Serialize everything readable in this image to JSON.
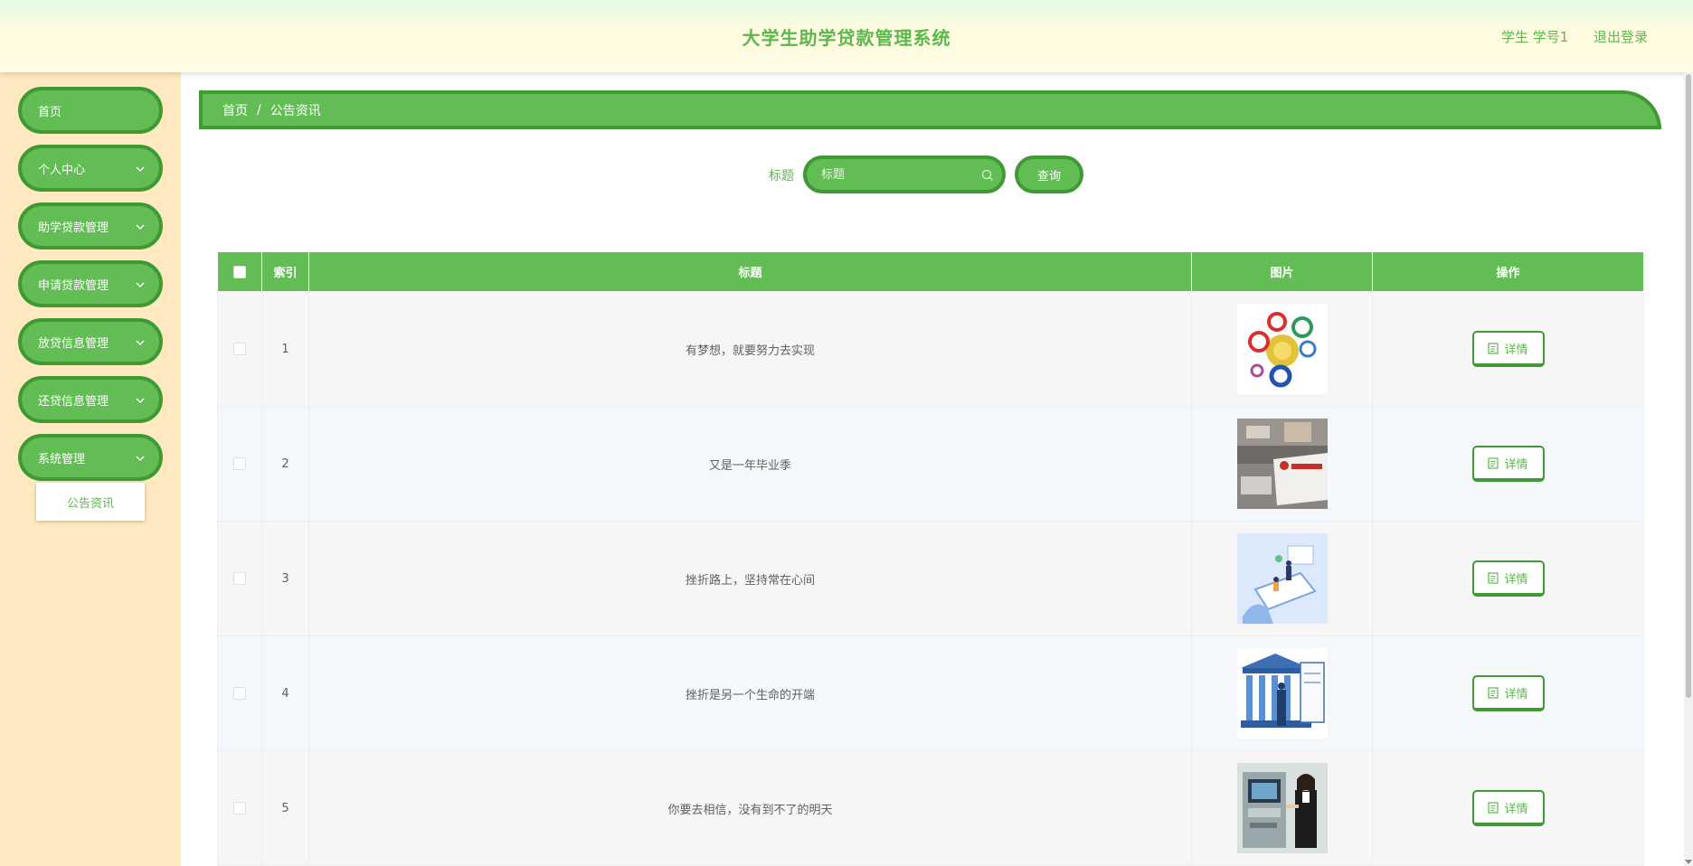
{
  "header": {
    "title": "大学生助学贷款管理系统",
    "user_label": "学生 学号1",
    "logout_label": "退出登录"
  },
  "sidebar": {
    "items": [
      {
        "label": "首页",
        "has_children": false
      },
      {
        "label": "个人中心",
        "has_children": true
      },
      {
        "label": "助学贷款管理",
        "has_children": true
      },
      {
        "label": "申请贷款管理",
        "has_children": true
      },
      {
        "label": "放贷信息管理",
        "has_children": true
      },
      {
        "label": "还贷信息管理",
        "has_children": true
      },
      {
        "label": "系统管理",
        "has_children": true
      }
    ],
    "submenu": {
      "label": "公告资讯"
    }
  },
  "breadcrumb": {
    "home": "首页",
    "separator": "/",
    "current": "公告资讯"
  },
  "search": {
    "label": "标题",
    "placeholder": "标题",
    "value": "",
    "button_label": "查询"
  },
  "table": {
    "columns": [
      "索引",
      "标题",
      "图片",
      "操作"
    ],
    "rows": [
      {
        "index": "1",
        "title": "有梦想，就要努力去实现",
        "image_icon": "bank-logos-thumbnail",
        "action_label": "详情"
      },
      {
        "index": "2",
        "title": "又是一年毕业季",
        "image_icon": "bank-counter-thumbnail",
        "action_label": "详情"
      },
      {
        "index": "3",
        "title": "挫折路上，坚持常在心间",
        "image_icon": "phone-illustration-thumbnail",
        "action_label": "详情"
      },
      {
        "index": "4",
        "title": "挫折是另一个生命的开端",
        "image_icon": "bank-building-thumbnail",
        "action_label": "详情"
      },
      {
        "index": "5",
        "title": "你要去相信，没有到不了的明天",
        "image_icon": "atm-service-thumbnail",
        "action_label": "详情"
      }
    ]
  },
  "colors": {
    "primary": "#62bd54",
    "primary_dark": "#3f9a34",
    "sidebar_bg": "#ffe9c0",
    "text_green": "#5cb84d"
  }
}
